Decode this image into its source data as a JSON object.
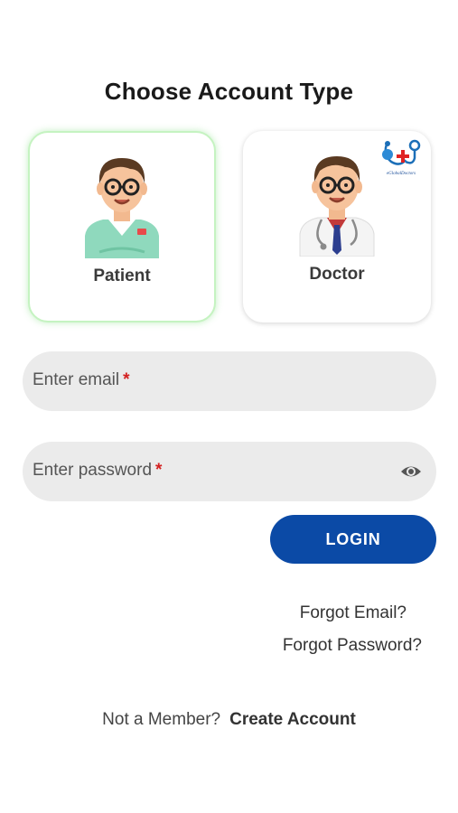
{
  "heading": "Choose Account Type",
  "account_types": {
    "patient_label": "Patient",
    "doctor_label": "Doctor"
  },
  "logo_text": "eGlobalDoctors",
  "form": {
    "email_placeholder": "Enter email",
    "password_placeholder": "Enter password",
    "required_marker": "*",
    "login_label": "LOGIN"
  },
  "links": {
    "forgot_email": "Forgot Email?",
    "forgot_password": "Forgot Password?"
  },
  "footer": {
    "prompt": "Not a Member?",
    "create_account": "Create Account"
  },
  "colors": {
    "primary_button": "#0b4aa6",
    "selected_border": "#c5f3c1",
    "field_bg": "#ebebeb",
    "required": "#d32020"
  }
}
